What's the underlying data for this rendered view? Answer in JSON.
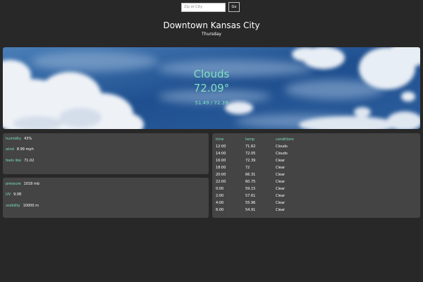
{
  "search": {
    "placeholder": "Zip or City",
    "button_label": "Go"
  },
  "header": {
    "city": "Downtown Kansas City",
    "day": "Thursday"
  },
  "current": {
    "condition": "Clouds",
    "temperature": "72.09°",
    "range": "51.49 / 72.39"
  },
  "details": {
    "humidity_label": "humidity",
    "humidity_value": "43%",
    "wind_label": "wind",
    "wind_value": "8.99 mph",
    "feels_label": "feels like",
    "feels_value": "71.02",
    "pressure_label": "pressure",
    "pressure_value": "1018 mb",
    "uv_label": "UV",
    "uv_value": "9.08",
    "visibility_label": "visibility",
    "visibility_value": "10000 m"
  },
  "forecast": {
    "headers": {
      "time": "time",
      "temp": "temp",
      "conditions": "conditions"
    },
    "rows": [
      {
        "time": "12:00",
        "temp": "71.62",
        "conditions": "Clouds"
      },
      {
        "time": "14:00",
        "temp": "72.05",
        "conditions": "Clouds"
      },
      {
        "time": "16:00",
        "temp": "72.39",
        "conditions": "Clear"
      },
      {
        "time": "18:00",
        "temp": "72",
        "conditions": "Clear"
      },
      {
        "time": "20:00",
        "temp": "66.31",
        "conditions": "Clear"
      },
      {
        "time": "22:00",
        "temp": "60.75",
        "conditions": "Clear"
      },
      {
        "time": "0:00",
        "temp": "59.15",
        "conditions": "Clear"
      },
      {
        "time": "2:00",
        "temp": "57.61",
        "conditions": "Clear"
      },
      {
        "time": "4:00",
        "temp": "55.96",
        "conditions": "Clear"
      },
      {
        "time": "6:00",
        "temp": "54.91",
        "conditions": "Clear"
      }
    ]
  },
  "colors": {
    "background": "#282828",
    "card": "#444444",
    "accent": "#7ee0c0",
    "sky": "#1f4f8f"
  }
}
